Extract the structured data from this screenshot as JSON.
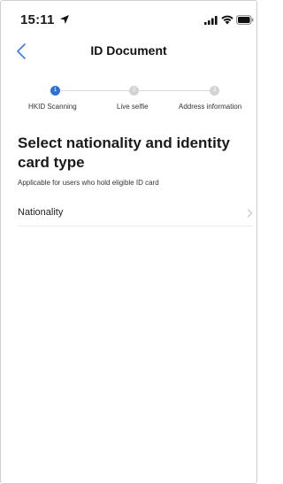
{
  "status_bar": {
    "time": "15:11",
    "location_icon": "location-arrow-icon",
    "signal_icon": "cellular-signal-icon",
    "wifi_icon": "wifi-icon",
    "battery_icon": "battery-icon"
  },
  "nav": {
    "back_icon": "chevron-left-icon",
    "title": "ID Document"
  },
  "stepper": {
    "steps": [
      {
        "number": "1",
        "label": "HKID Scanning",
        "active": true
      },
      {
        "number": "2",
        "label": "Live selfie",
        "active": false
      },
      {
        "number": "3",
        "label": "Address information",
        "active": false
      }
    ]
  },
  "content": {
    "heading": "Select nationality and identity card type",
    "subtitle": "Applicable for users who hold eligible ID card",
    "nationality_label": "Nationality",
    "nationality_chevron": "chevron-right-icon"
  },
  "colors": {
    "accent": "#2f6fd6",
    "inactive_dot": "#d3d3d3",
    "back_icon": "#3b7be8"
  }
}
